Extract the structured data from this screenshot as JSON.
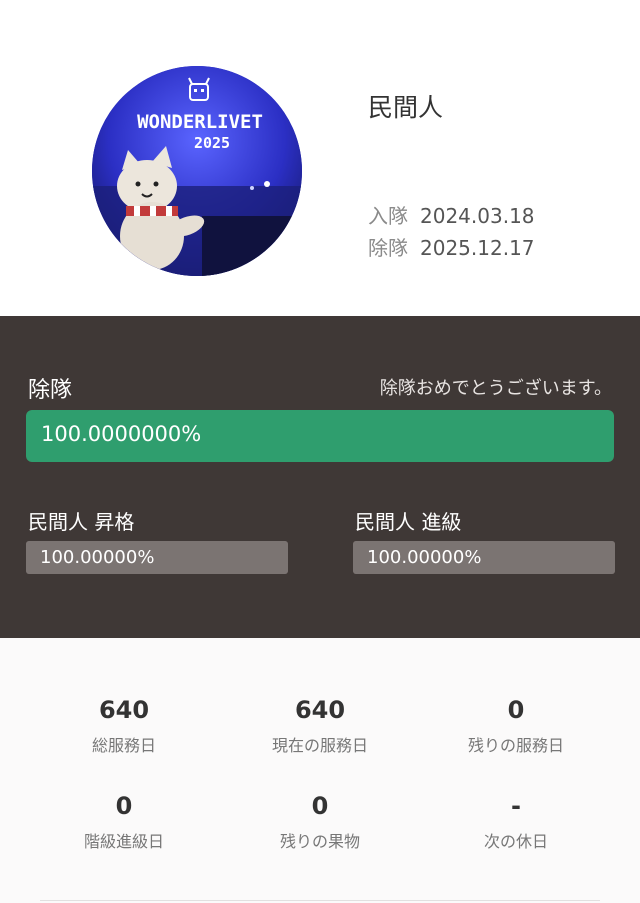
{
  "profile": {
    "avatar_text_line1": "WONDERLIVET",
    "avatar_text_line2": "2025",
    "rank": "民間人",
    "enlist_label": "入隊",
    "enlist_date": "2024.03.18",
    "discharge_label": "除隊",
    "discharge_date": "2025.12.17"
  },
  "progress": {
    "main_label": "除隊",
    "main_message": "除隊おめでとうございます。",
    "main_value_text": "100.0000000%",
    "main_fraction": 1.0,
    "promotion_label": "民間人 昇格",
    "promotion_value_text": "100.00000%",
    "promotion_fraction": 1.0,
    "advance_label": "民間人 進級",
    "advance_value_text": "100.00000%",
    "advance_fraction": 1.0,
    "main_bar_color": "#2f9e6e"
  },
  "stats": [
    {
      "value": "640",
      "label": "総服務日"
    },
    {
      "value": "640",
      "label": "現在の服務日"
    },
    {
      "value": "0",
      "label": "残りの服務日"
    },
    {
      "value": "0",
      "label": "階級進級日"
    },
    {
      "value": "0",
      "label": "残りの果物"
    },
    {
      "value": "-",
      "label": "次の休日"
    }
  ]
}
